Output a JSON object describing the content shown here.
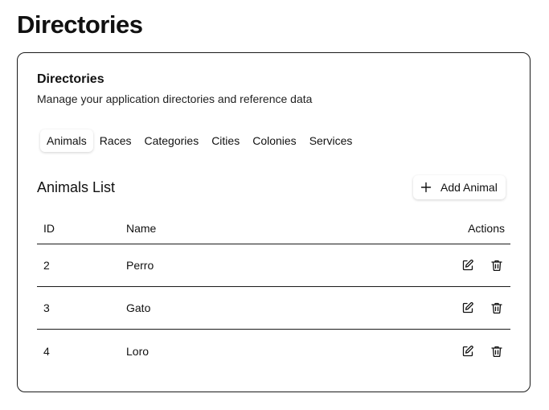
{
  "page": {
    "title": "Directories"
  },
  "card": {
    "title": "Directories",
    "description": "Manage your application directories and reference data"
  },
  "tabs": [
    {
      "label": "Animals",
      "active": true
    },
    {
      "label": "Races",
      "active": false
    },
    {
      "label": "Categories",
      "active": false
    },
    {
      "label": "Cities",
      "active": false
    },
    {
      "label": "Colonies",
      "active": false
    },
    {
      "label": "Services",
      "active": false
    }
  ],
  "list": {
    "title": "Animals List",
    "add_button_label": "Add Animal",
    "add_button_icon": "plus-icon"
  },
  "table": {
    "headers": {
      "id": "ID",
      "name": "Name",
      "actions": "Actions"
    },
    "rows": [
      {
        "id": "2",
        "name": "Perro"
      },
      {
        "id": "3",
        "name": "Gato"
      },
      {
        "id": "4",
        "name": "Loro"
      }
    ],
    "row_action_icons": [
      "edit-icon",
      "trash-icon"
    ]
  }
}
